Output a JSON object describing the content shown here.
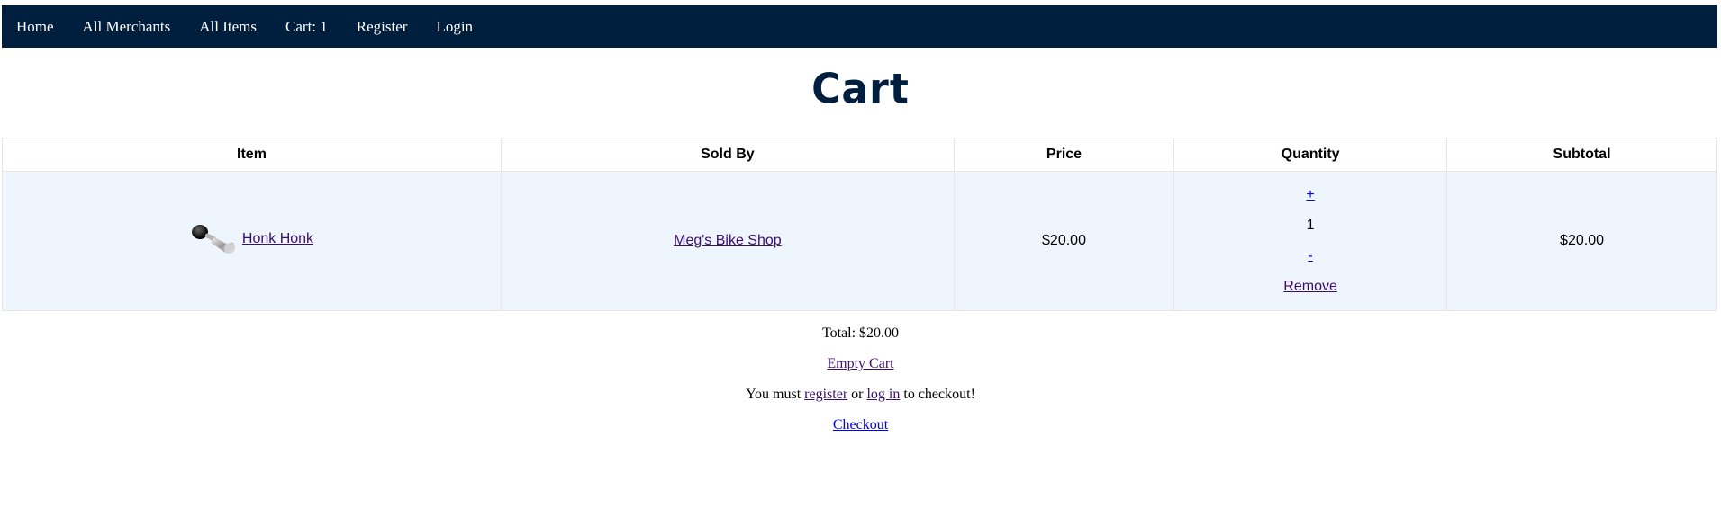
{
  "nav": {
    "items": [
      {
        "label": "Home"
      },
      {
        "label": "All Merchants"
      },
      {
        "label": "All Items"
      },
      {
        "label": "Cart: 1"
      },
      {
        "label": "Register"
      },
      {
        "label": "Login"
      }
    ],
    "background": "#001f3e"
  },
  "page": {
    "title": "Cart"
  },
  "table": {
    "headers": [
      "Item",
      "Sold By",
      "Price",
      "Quantity",
      "Subtotal"
    ],
    "rows": [
      {
        "item_name": "Honk Honk",
        "image_icon": "bike-horn-icon",
        "sold_by": "Meg's Bike Shop",
        "price": "$20.00",
        "increment": "+",
        "quantity": "1",
        "decrement": "-",
        "remove": "Remove",
        "subtotal": "$20.00"
      }
    ],
    "row_background": "#eef5fd"
  },
  "summary": {
    "total": "Total: $20.00",
    "empty_cart": "Empty Cart",
    "msg_before": "You must ",
    "register_link": "register",
    "msg_middle": " or ",
    "login_link": "log in",
    "msg_after": " to checkout!",
    "checkout": "Checkout"
  }
}
